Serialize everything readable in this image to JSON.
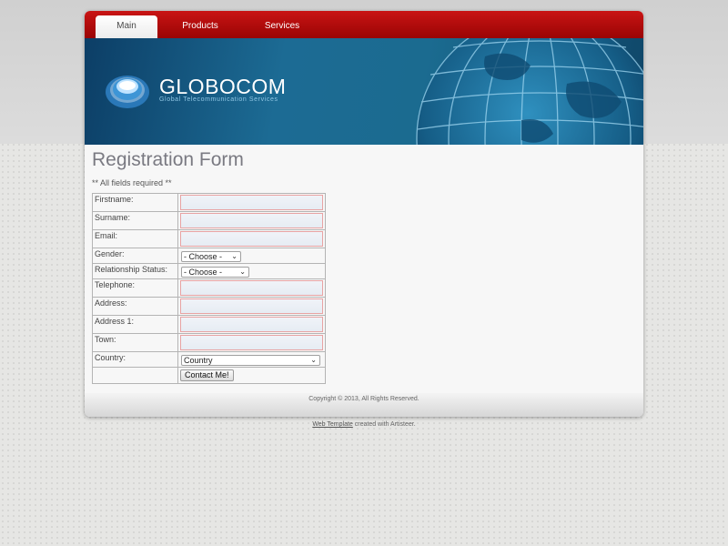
{
  "nav": {
    "items": [
      {
        "label": "Main",
        "active": true
      },
      {
        "label": "Products",
        "active": false
      },
      {
        "label": "Services",
        "active": false
      }
    ]
  },
  "header": {
    "title": "GLOBOCOM",
    "slogan": "Global Telecommunication Services"
  },
  "page": {
    "title": "Registration Form",
    "note": "** All fields required **"
  },
  "form": {
    "firstname_label": "Firstname:",
    "surname_label": "Surname:",
    "email_label": "Email:",
    "gender_label": "Gender:",
    "gender_value": "- Choose -",
    "relationship_label": "Relationship Status:",
    "relationship_value": "- Choose -",
    "telephone_label": "Telephone:",
    "address_label": "Address:",
    "address1_label": "Address 1:",
    "town_label": "Town:",
    "country_label": "Country:",
    "country_value": "Country",
    "submit_label": "Contact Me!"
  },
  "footer": {
    "copyright": "Copyright © 2013,  All Rights Reserved."
  },
  "credit": {
    "link": "Web Template",
    "text": " created with Artisteer."
  },
  "colors": {
    "nav_red": "#b20c0c",
    "header_blue": "#1b6b90",
    "field_border": "#e8a3a3"
  }
}
